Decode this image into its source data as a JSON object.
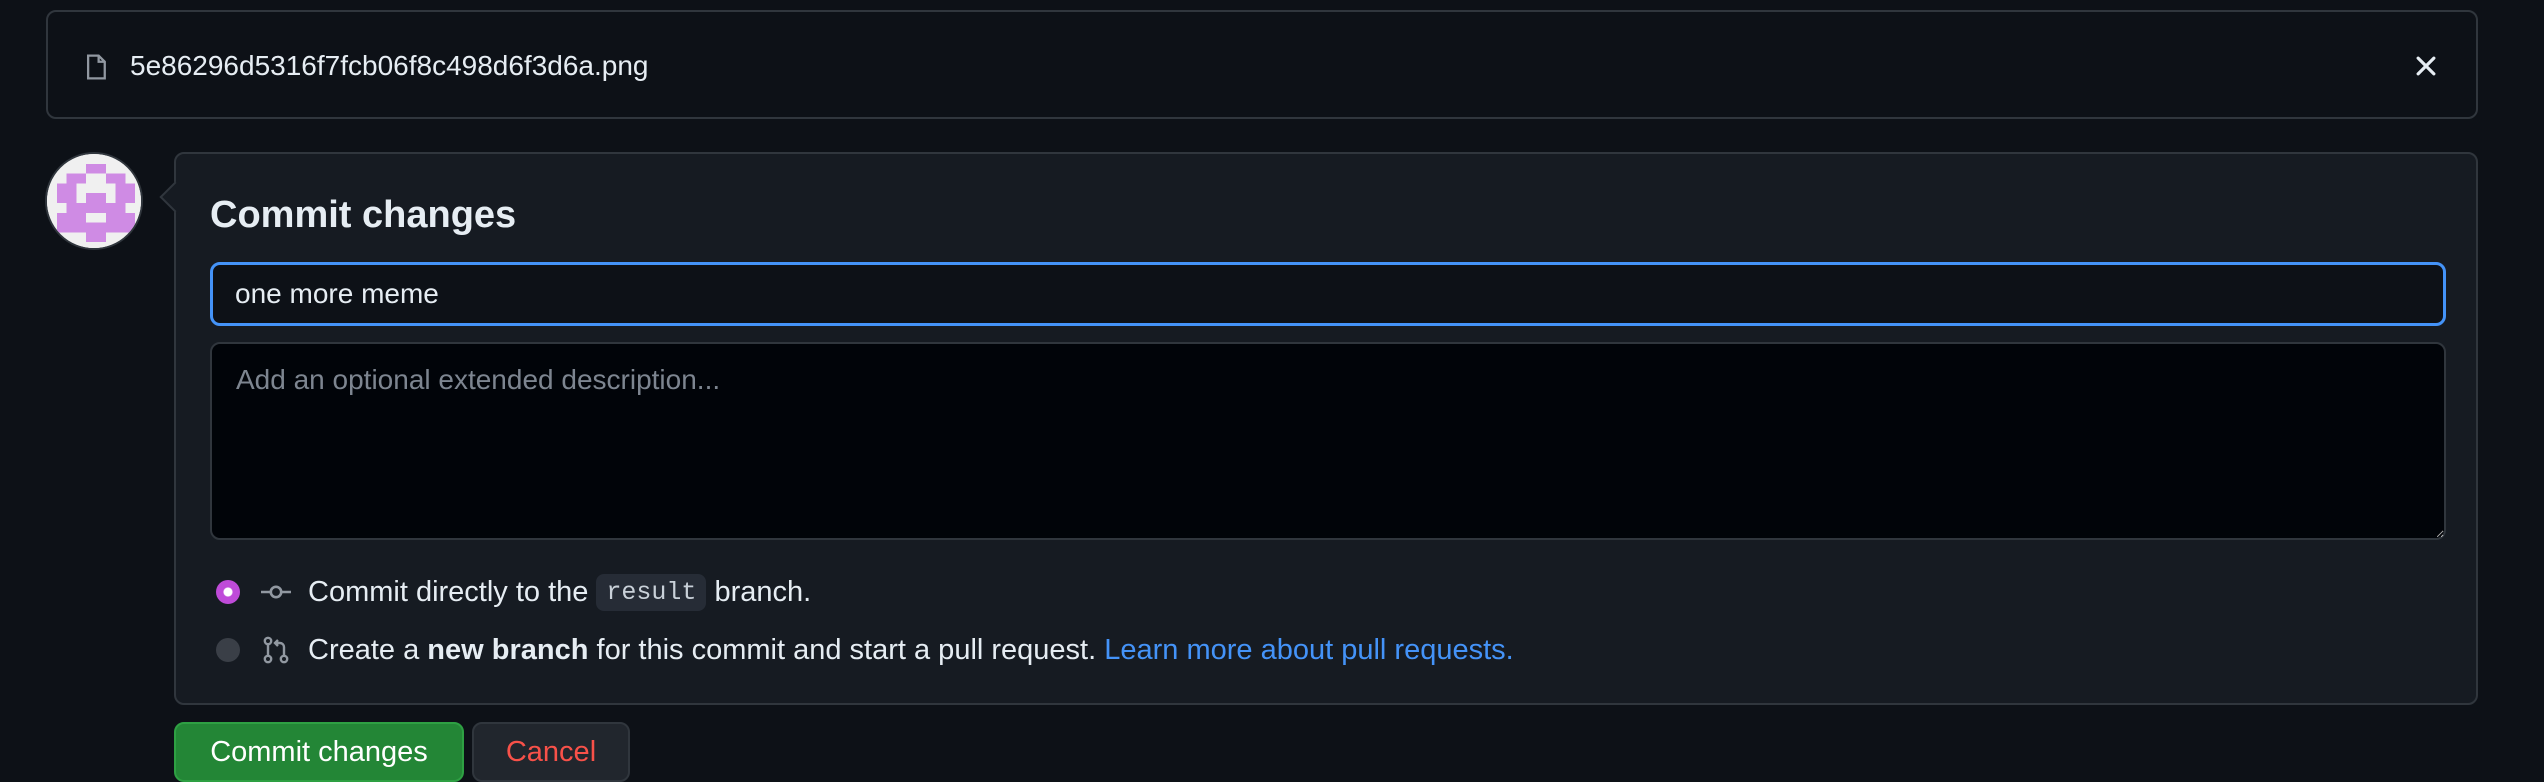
{
  "file": {
    "name": "5e86296d5316f7fcb06f8c498d6f3d6a.png",
    "file_icon": "file-icon",
    "close_icon": "x-icon"
  },
  "commit": {
    "title": "Commit changes",
    "summary_value": "one more meme",
    "description_placeholder": "Add an optional extended description...",
    "options": [
      {
        "icon": "git-commit-icon",
        "selected": true,
        "text_before": "Commit directly to the",
        "branch": "result",
        "text_after": "branch."
      },
      {
        "icon": "git-pull-request-icon",
        "selected": false,
        "text_before": "Create a",
        "bold": "new branch",
        "text_after": "for this commit and start a pull request.",
        "link": "Learn more about pull requests."
      }
    ]
  },
  "buttons": {
    "commit_label": "Commit changes",
    "cancel_label": "Cancel"
  },
  "colors": {
    "accent_blue": "#4493f8",
    "commit_green": "#238636",
    "cancel_red": "#f85149",
    "radio_selected": "#bf4bd9"
  }
}
